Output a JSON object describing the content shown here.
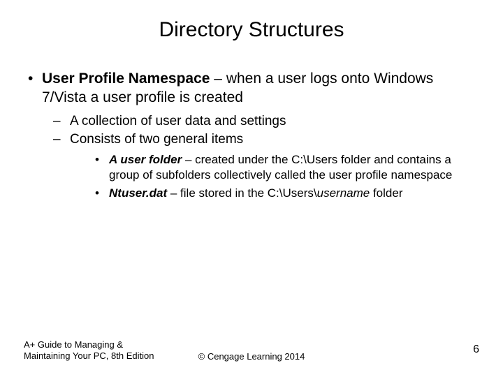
{
  "title": "Directory Structures",
  "bullet1": {
    "term": "User Profile Namespace",
    "rest": " – when a user logs onto Windows 7/Vista a user profile is created"
  },
  "sub": {
    "a": "A collection of user data and settings",
    "b": "Consists of two general items"
  },
  "subsub": {
    "a_term": "A user folder",
    "a_rest": " – created under the C:\\Users folder and contains a group of subfolders collectively called the user profile namespace",
    "b_term": "Ntuser.dat",
    "b_rest_1": " – file stored in the C:\\Users\\",
    "b_rest_user": "username",
    "b_rest_2": " folder"
  },
  "footer": {
    "left": "A+ Guide to Managing & Maintaining Your PC, 8th Edition",
    "center": "© Cengage Learning  2014",
    "page": "6"
  }
}
